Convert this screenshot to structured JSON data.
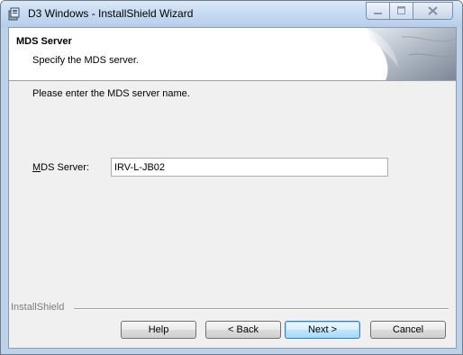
{
  "window": {
    "title": "D3 Windows - InstallShield Wizard"
  },
  "banner": {
    "title": "MDS Server",
    "subtitle": "Specify the MDS server."
  },
  "main": {
    "instruction": "Please enter the MDS server name.",
    "mds_server_label_prefix": "",
    "mds_server_label_mnemonic": "M",
    "mds_server_label_rest": "DS Server:",
    "mds_server_value": "IRV-L-JB02"
  },
  "footer": {
    "brand": "InstallShield",
    "help_label": "Help",
    "back_label": "< Back",
    "back_mnemonic": "B",
    "next_label": "Next >",
    "next_mnemonic": "N",
    "cancel_label": "Cancel"
  },
  "icons": {
    "app": "installer-icon",
    "minimize": "minimize-icon",
    "maximize": "maximize-icon",
    "close": "close-icon"
  }
}
